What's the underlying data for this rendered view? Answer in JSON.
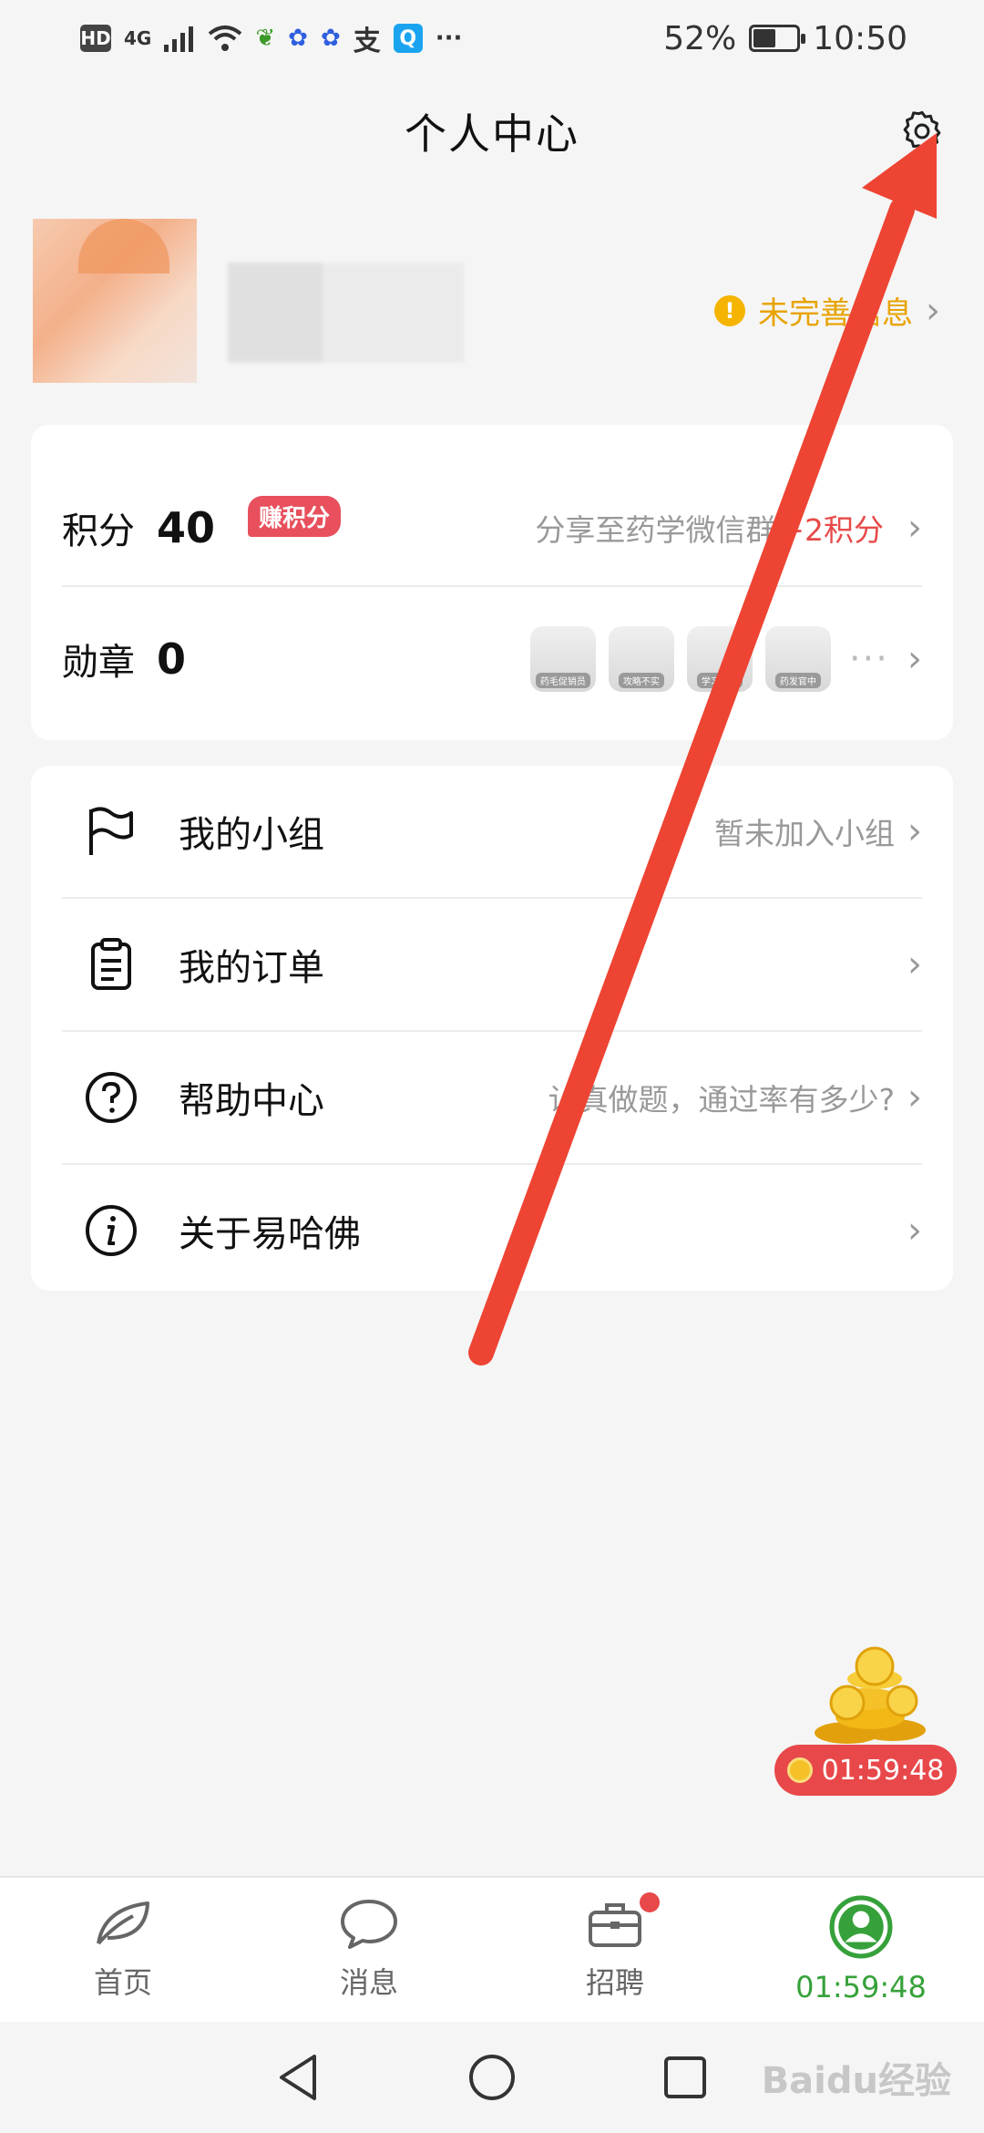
{
  "status_bar": {
    "hd": "HD",
    "network": "4G",
    "battery": "52%",
    "battery_level": 0.52,
    "time": "10:50",
    "more": "···"
  },
  "header": {
    "title": "个人中心",
    "settings_icon": "gear-icon"
  },
  "profile": {
    "incomplete_label": "未完善信息"
  },
  "points": {
    "label": "积分",
    "value": "40",
    "badge": "赚积分",
    "share_text": "分享至药学微信群",
    "reward_text": "+2积分"
  },
  "medals": {
    "label": "勋章",
    "value": "0",
    "badges": [
      "药毛促销员",
      "攻略不实",
      "学习积极",
      "药发官中"
    ],
    "more": "···"
  },
  "menu": [
    {
      "label": "我的小组",
      "right": "暂未加入小组",
      "icon": "flag-icon"
    },
    {
      "label": "我的订单",
      "right": "",
      "icon": "clipboard-icon"
    },
    {
      "label": "帮助中心",
      "right": "认真做题，通过率有多少?",
      "icon": "question-icon"
    },
    {
      "label": "关于易哈佛",
      "right": "",
      "icon": "info-icon"
    }
  ],
  "coin_timer": "01:59:48",
  "tabs": [
    {
      "label": "首页",
      "icon": "leaf-icon"
    },
    {
      "label": "消息",
      "icon": "chat-bubble-icon"
    },
    {
      "label": "招聘",
      "icon": "briefcase-icon"
    },
    {
      "label": "01:59:48",
      "icon": "user-icon"
    }
  ],
  "colors": {
    "accent": "#36a13a",
    "warning": "#e8a300",
    "red": "#e84a4a",
    "arrow": "#ee4433"
  },
  "watermark": "Baidu经验"
}
